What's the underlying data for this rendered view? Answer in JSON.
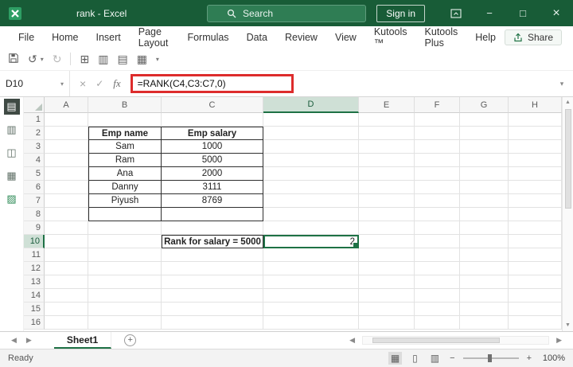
{
  "colors": {
    "titlebar": "#185c37",
    "accent": "#217346",
    "selection": "#1e7145",
    "annotation_red": "#dd2c2c"
  },
  "titlebar": {
    "title": "rank - Excel",
    "search": "Search",
    "sign_in": "Sign in"
  },
  "menu": {
    "tabs": [
      "File",
      "Home",
      "Insert",
      "Page Layout",
      "Formulas",
      "Data",
      "Review",
      "View",
      "Kutools ™",
      "Kutools Plus",
      "Help"
    ],
    "share": "Share"
  },
  "formula_bar": {
    "name_box": "D10",
    "formula": "=RANK(C4,C3:C7,0)",
    "fx": "fx"
  },
  "sheet": {
    "columns": [
      "A",
      "B",
      "C",
      "D",
      "E",
      "F",
      "G",
      "H"
    ],
    "row_count": 16,
    "selected": {
      "col": "D",
      "row": 10,
      "ref": "D10"
    },
    "cells": [
      {
        "ref": "B2",
        "text": "Emp name",
        "bold": true,
        "box": true,
        "bl": true,
        "bt": true
      },
      {
        "ref": "C2",
        "text": "Emp salary",
        "bold": true,
        "box": true,
        "bt": true
      },
      {
        "ref": "B3",
        "text": "Sam",
        "box": true,
        "bl": true
      },
      {
        "ref": "C3",
        "text": "1000",
        "box": true
      },
      {
        "ref": "B4",
        "text": "Ram",
        "box": true,
        "bl": true
      },
      {
        "ref": "C4",
        "text": "5000",
        "box": true
      },
      {
        "ref": "B5",
        "text": "Ana",
        "box": true,
        "bl": true
      },
      {
        "ref": "C5",
        "text": "2000",
        "box": true
      },
      {
        "ref": "B6",
        "text": "Danny",
        "box": true,
        "bl": true
      },
      {
        "ref": "C6",
        "text": "3111",
        "box": true
      },
      {
        "ref": "B7",
        "text": "Piyush",
        "box": true,
        "bl": true
      },
      {
        "ref": "C7",
        "text": "8769",
        "box": true
      },
      {
        "ref": "B8",
        "text": "",
        "box": true,
        "bl": true
      },
      {
        "ref": "C8",
        "text": "",
        "box": true
      },
      {
        "ref": "C10",
        "text": "Rank for salary = 5000",
        "bold": true,
        "box": true,
        "bl": true,
        "bt": true
      },
      {
        "ref": "D10",
        "text": "2",
        "align": "right",
        "selected": true
      }
    ]
  },
  "tabs_bar": {
    "sheet": "Sheet1"
  },
  "status_bar": {
    "status": "Ready",
    "zoom": "100%"
  },
  "icons": {
    "undo": "↺",
    "redo": "↻",
    "dropdown": "▾",
    "cancel": "×",
    "confirm": "✓",
    "scroll_up": "▲",
    "scroll_down": "▼",
    "tab_left": "◀",
    "tab_right": "▶",
    "minimize": "−",
    "maximize": "□",
    "close": "×",
    "add_sheet": "+",
    "qat_1": "⊞",
    "qat_2": "▥",
    "qat_3": "▤",
    "qat_4": "▦",
    "pane_toggle": "▤",
    "pane_1": "▥",
    "pane_2": "◫",
    "pane_3": "▦",
    "pane_4": "▨",
    "view_normal": "▦",
    "view_layout": "▯",
    "view_break": "▥",
    "zoom_out": "−",
    "zoom_in": "+"
  }
}
